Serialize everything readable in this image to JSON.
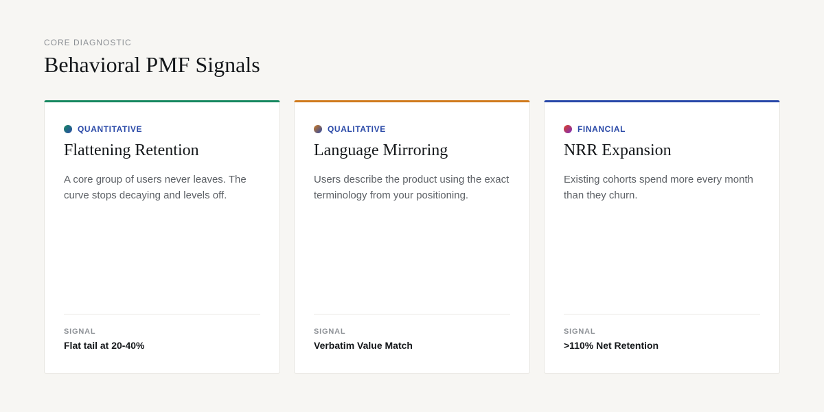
{
  "header": {
    "eyebrow": "CORE DIAGNOSTIC",
    "title": "Behavioral PMF Signals"
  },
  "cards": [
    {
      "accent": "#15875f",
      "dot_gradient": [
        "#15875f",
        "#2b4aa8"
      ],
      "tag": "QUANTITATIVE",
      "title": "Flattening Retention",
      "description": "A core group of users never leaves. The curve stops decaying and levels off.",
      "signal_label": "SIGNAL",
      "signal_value": "Flat tail at 20-40%"
    },
    {
      "accent": "#d07a1c",
      "dot_gradient": [
        "#d07a1c",
        "#2b4aa8"
      ],
      "tag": "QUALITATIVE",
      "title": "Language Mirroring",
      "description": "Users describe the product using the exact terminology from your positioning.",
      "signal_label": "SIGNAL",
      "signal_value": "Verbatim Value Match"
    },
    {
      "accent": "#2646a8",
      "dot_gradient": [
        "#e0401f",
        "#7a2ec0"
      ],
      "tag": "FINANCIAL",
      "title": "NRR Expansion",
      "description": "Existing cohorts spend more every month than they churn.",
      "signal_label": "SIGNAL",
      "signal_value": ">110% Net Retention"
    }
  ]
}
